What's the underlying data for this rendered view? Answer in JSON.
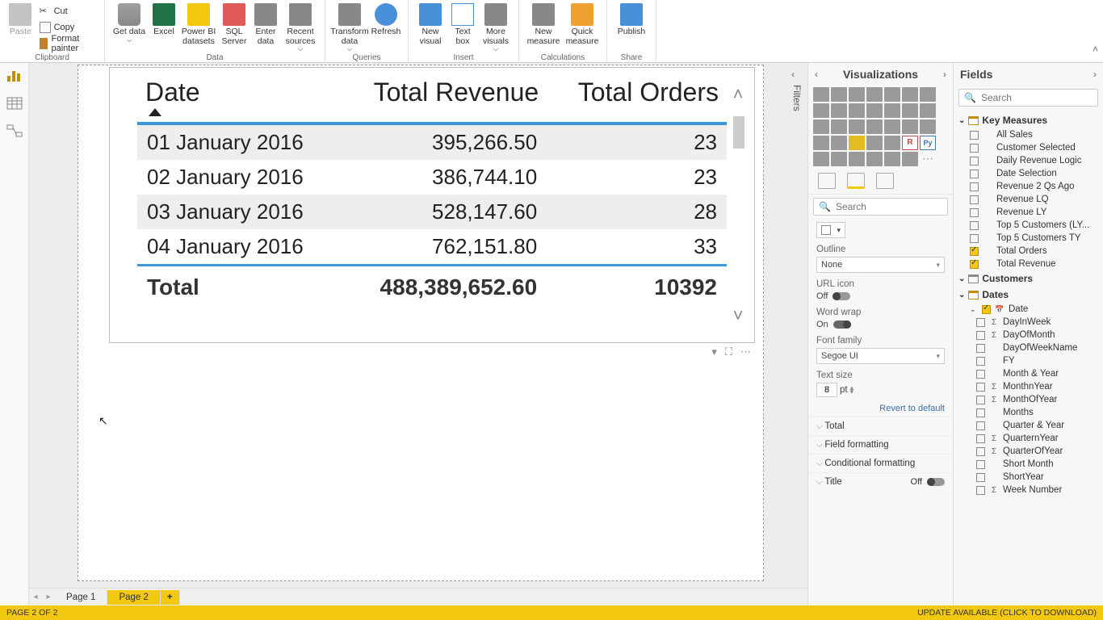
{
  "ribbon": {
    "clipboard": {
      "title": "Clipboard",
      "paste": "Paste",
      "cut": "Cut",
      "copy": "Copy",
      "format_painter": "Format painter"
    },
    "data": {
      "title": "Data",
      "get_data": "Get data",
      "excel": "Excel",
      "pbi_datasets": "Power BI datasets",
      "sql": "SQL Server",
      "enter": "Enter data",
      "recent": "Recent sources"
    },
    "queries": {
      "title": "Queries",
      "transform": "Transform data",
      "refresh": "Refresh"
    },
    "insert": {
      "title": "Insert",
      "new_visual": "New visual",
      "text_box": "Text box",
      "more_visuals": "More visuals"
    },
    "calculations": {
      "title": "Calculations",
      "new_measure": "New measure",
      "quick_measure": "Quick measure"
    },
    "share": {
      "title": "Share",
      "publish": "Publish"
    }
  },
  "filters_label": "Filters",
  "viz_pane": {
    "title": "Visualizations",
    "search": "Search",
    "r_label": "R",
    "py_label": "Py",
    "outline_label": "Outline",
    "outline_value": "None",
    "url_icon_label": "URL icon",
    "url_icon_state": "Off",
    "word_wrap_label": "Word wrap",
    "word_wrap_state": "On",
    "font_family_label": "Font family",
    "font_family_value": "Segoe UI",
    "text_size_label": "Text size",
    "text_size_value": "8",
    "text_size_unit": "pt",
    "revert": "Revert to default",
    "sections": {
      "total": "Total",
      "field_formatting": "Field formatting",
      "conditional_formatting": "Conditional formatting",
      "title": "Title",
      "title_state": "Off"
    }
  },
  "fields_pane": {
    "title": "Fields",
    "search": "Search",
    "groups": {
      "key_measures": {
        "label": "Key Measures",
        "items": [
          {
            "label": "All Sales",
            "checked": false,
            "type": "calc"
          },
          {
            "label": "Customer Selected",
            "checked": false,
            "type": "calc"
          },
          {
            "label": "Daily Revenue Logic",
            "checked": false,
            "type": "calc"
          },
          {
            "label": "Date Selection",
            "checked": false,
            "type": "calc"
          },
          {
            "label": "Revenue 2 Qs Ago",
            "checked": false,
            "type": "calc"
          },
          {
            "label": "Revenue LQ",
            "checked": false,
            "type": "calc"
          },
          {
            "label": "Revenue LY",
            "checked": false,
            "type": "calc"
          },
          {
            "label": "Top 5 Customers (LY...",
            "checked": false,
            "type": "calc"
          },
          {
            "label": "Top 5 Customers TY",
            "checked": false,
            "type": "calc"
          },
          {
            "label": "Total Orders",
            "checked": true,
            "type": "calc"
          },
          {
            "label": "Total Revenue",
            "checked": true,
            "type": "calc"
          }
        ]
      },
      "customers": {
        "label": "Customers"
      },
      "dates": {
        "label": "Dates",
        "items": [
          {
            "label": "Date",
            "checked": true,
            "type": "date"
          },
          {
            "label": "DayInWeek",
            "checked": false,
            "type": "sigma"
          },
          {
            "label": "DayOfMonth",
            "checked": false,
            "type": "sigma"
          },
          {
            "label": "DayOfWeekName",
            "checked": false,
            "type": ""
          },
          {
            "label": "FY",
            "checked": false,
            "type": ""
          },
          {
            "label": "Month & Year",
            "checked": false,
            "type": ""
          },
          {
            "label": "MonthnYear",
            "checked": false,
            "type": "sigma"
          },
          {
            "label": "MonthOfYear",
            "checked": false,
            "type": "sigma"
          },
          {
            "label": "Months",
            "checked": false,
            "type": ""
          },
          {
            "label": "Quarter & Year",
            "checked": false,
            "type": ""
          },
          {
            "label": "QuarternYear",
            "checked": false,
            "type": "sigma"
          },
          {
            "label": "QuarterOfYear",
            "checked": false,
            "type": "sigma"
          },
          {
            "label": "Short Month",
            "checked": false,
            "type": ""
          },
          {
            "label": "ShortYear",
            "checked": false,
            "type": ""
          },
          {
            "label": "Week Number",
            "checked": false,
            "type": "sigma"
          }
        ]
      }
    }
  },
  "tabs": {
    "page1": "Page 1",
    "page2": "Page 2",
    "add": "+"
  },
  "status": {
    "left": "PAGE 2 OF 2",
    "right": "UPDATE AVAILABLE (CLICK TO DOWNLOAD)"
  },
  "chart_data": {
    "type": "table",
    "columns": [
      "Date",
      "Total Revenue",
      "Total Orders"
    ],
    "rows": [
      {
        "date": "01 January 2016",
        "revenue": "395,266.50",
        "orders": "23"
      },
      {
        "date": "02 January 2016",
        "revenue": "386,744.10",
        "orders": "23"
      },
      {
        "date": "03 January 2016",
        "revenue": "528,147.60",
        "orders": "28"
      },
      {
        "date": "04 January 2016",
        "revenue": "762,151.80",
        "orders": "33"
      }
    ],
    "total": {
      "label": "Total",
      "revenue": "488,389,652.60",
      "orders": "10392"
    }
  }
}
